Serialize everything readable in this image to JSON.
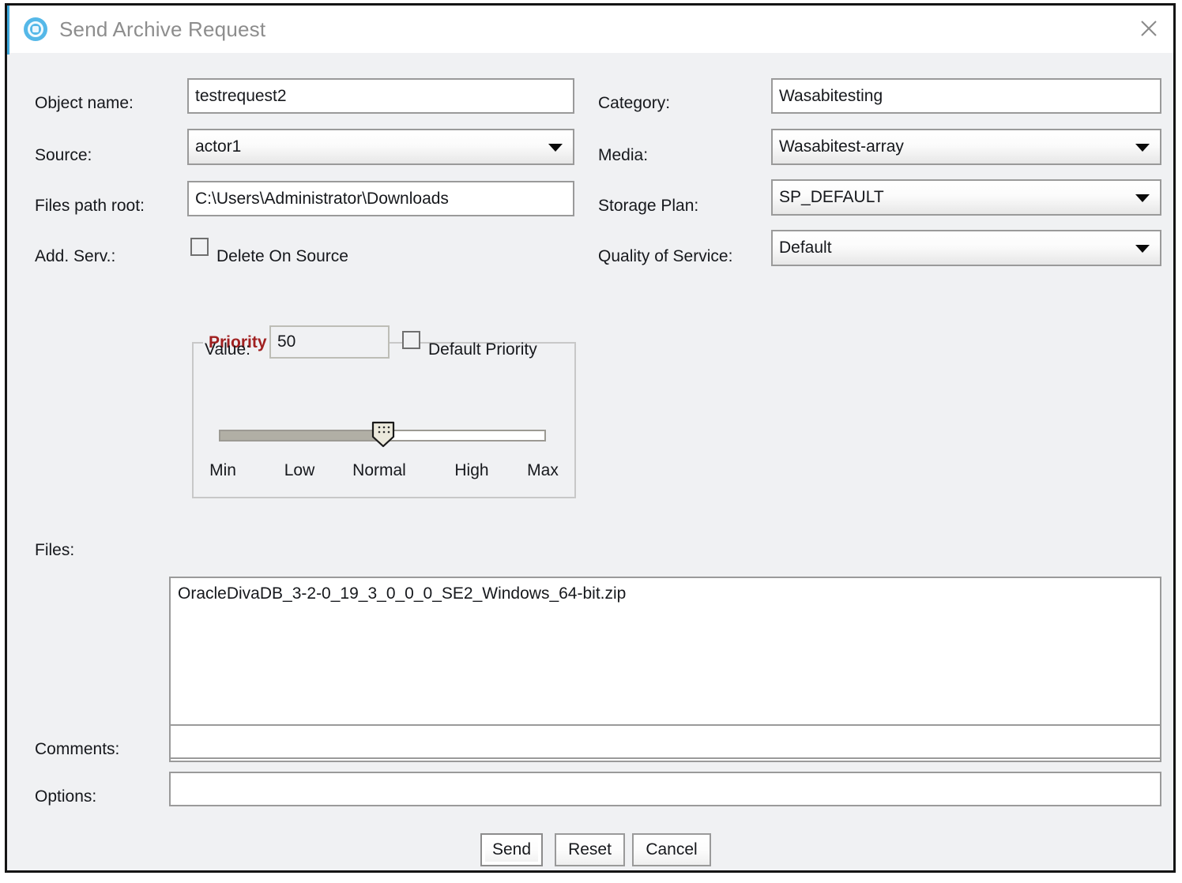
{
  "window": {
    "title": "Send Archive Request",
    "app_icon": "archive-app-icon",
    "close_icon": "close-icon",
    "accent_color": "#3ea9dd",
    "background_color": "#f0f1f3"
  },
  "form": {
    "object_name": {
      "label": "Object name:",
      "value": "testrequest2",
      "placeholder": ""
    },
    "source": {
      "label": "Source:",
      "value": "actor1"
    },
    "files_path_root": {
      "label": "Files path root:",
      "value": "C:\\Users\\Administrator\\Downloads",
      "placeholder": ""
    },
    "add_serv": {
      "label": "Add. Serv.:",
      "checkbox_label": "Delete On Source",
      "checked": false
    },
    "category": {
      "label": "Category:",
      "value": "Wasabitesting",
      "placeholder": ""
    },
    "media": {
      "label": "Media:",
      "value": "Wasabitest-array"
    },
    "storage_plan": {
      "label": "Storage Plan:",
      "value": "SP_DEFAULT"
    },
    "quality_of_service": {
      "label": "Quality of Service:",
      "value": "Default"
    },
    "files": {
      "label": "Files:",
      "value": "OracleDivaDB_3-2-0_19_3_0_0_0_SE2_Windows_64-bit.zip"
    },
    "comments": {
      "label": "Comments:",
      "value": "",
      "placeholder": ""
    },
    "options": {
      "label": "Options:",
      "value": "",
      "placeholder": ""
    }
  },
  "priority": {
    "legend": "Priority",
    "legend_color": "#a02020",
    "value_label": "Value:",
    "value": "50",
    "default_checkbox_label": "Default Priority",
    "default_checked": false,
    "slider": {
      "min": 0,
      "max": 100,
      "current": 50,
      "ticks": [
        "Min",
        "Low",
        "Normal",
        "High",
        "Max"
      ]
    }
  },
  "buttons": {
    "send": "Send",
    "reset": "Reset",
    "cancel": "Cancel"
  }
}
